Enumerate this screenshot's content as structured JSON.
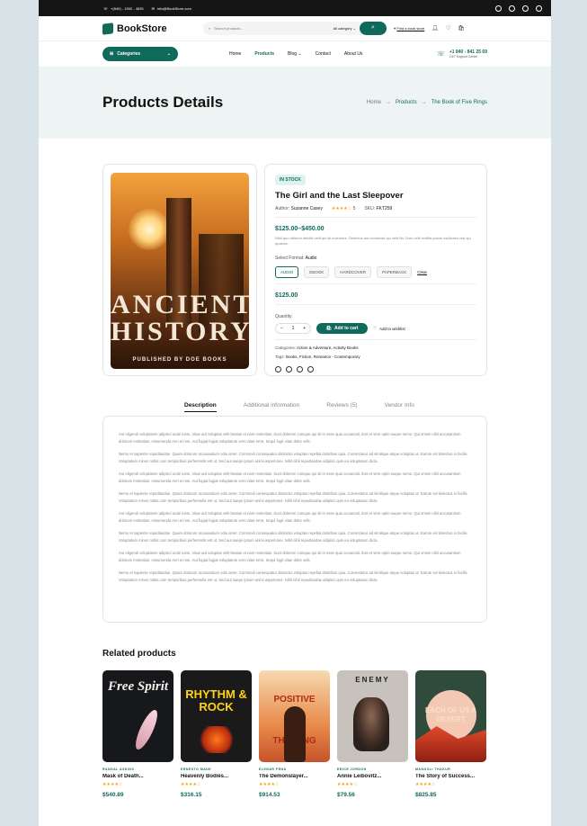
{
  "topbar": {
    "phone": "+(840) - 1500 - 4635",
    "email": "info@BookStore.com"
  },
  "header": {
    "logo": "BookStore",
    "search_placeholder": "Search products...",
    "category": "All category",
    "find_store": "Find a book store"
  },
  "nav": {
    "categories": "Categories",
    "links": [
      "Home",
      "Products",
      "Blog",
      "Contact",
      "About Us"
    ],
    "phone": "+1 840 - 841 25 69",
    "support": "24/7 Support Center"
  },
  "hero": {
    "title": "Products Details",
    "crumbs": [
      "Home",
      "Products",
      "The Book of Five Rings"
    ]
  },
  "cover": {
    "line1": "ANCIENT",
    "line2": "HISTORY",
    "publisher": "PUBLISHED BY DOE BOOKS"
  },
  "product": {
    "badge": "IN STOCK",
    "title": "The Girl and the Last Sleepover",
    "author_label": "Author:",
    "author": "Suzanne Casey",
    "rating": 4,
    "rating_text": "5",
    "sku_label": "SKU:",
    "sku": "FKT259",
    "price_range": "$125.00–$450.00",
    "short_desc": "Nihil quo deleum debitis velit qui sit inventore. Delectus aut occaecati qui velit illo. Dolo velit molitia ipsam explicabo nisi qui quaerat.",
    "format_label": "Select Format:",
    "format_value": "Audio",
    "formats": [
      "AUDIO",
      "EBOOK",
      "HARDCOVER",
      "PAPERBACK"
    ],
    "selected_format": "AUDIO",
    "clear": "Clear",
    "price": "$125.00",
    "quantity_label": "Quantity",
    "quantity": "1",
    "add_to_cart": "Add to cart",
    "wishlist": "Add to wishlist",
    "categories_label": "Categories:",
    "categories": "Action & Adventure, Activity Books",
    "tags_label": "Tags:",
    "tags": "Books, Fiction, Romance - Contemporary"
  },
  "tabs": [
    "Description",
    "Additional information",
    "Reviews (5)",
    "Vendor Info"
  ],
  "description": [
    "Aut eligendi voluptatem adipisci unde iusto. Vitae aut voluptas velit beatae et nam molestias. Sunt dolorem cumque qui sit in esse quia occaecati. Eos et vero optio eaque nemo. Qui omnis nihil accusantium dolorum molestias. Assumenda rem et non. Aut fugiat fugiat voluptatum vero vitae error. Sequi fugit vitae dolor velit.",
    "Nemo et sapiente repudiandae. Quam dolorum accusantium odio amet. Commodi consequatur distinctio voluptas repellat doloribus quia. Consectetur ad similique atque voluptas ut. Earum vel delectus in facilis. Voluptatum minus nobis cum temporibus perferendis est ut. Sed aut saepe ipsum animi asperiores. Nihil nihil repudiandae adipisci quis ea voluptatum dicta.",
    "Aut eligendi voluptatem adipisci unde iusto. Vitae aut voluptas velit beatae et nam molestias. Sunt dolorem cumque qui sit in esse quia occaecati. Eos et vero optio eaque nemo. Qui omnis nihil accusantium dolorum molestias. Assumenda rem et non. Aut fugiat fugiat voluptatum vero vitae error. Sequi fugit vitae dolor velit.",
    "Nemo et sapiente repudiandae. Quam dolorum accusantium odio amet. Commodi consequatur distinctio voluptas repellat doloribus quia. Consectetur ad similique atque voluptas ut. Earum vel delectus in facilis. Voluptatum minus nobis cum temporibus perferendis est ut. Sed aut saepe ipsum animi asperiores. Nihil nihil repudiandae adipisci quis ea voluptatum dicta.",
    "Aut eligendi voluptatem adipisci unde iusto. Vitae aut voluptas velit beatae et nam molestias. Sunt dolorem cumque qui sit in esse quia occaecati. Eos et vero optio eaque nemo. Qui omnis nihil accusantium dolorum molestias. Assumenda rem et non. Aut fugiat fugiat voluptatum vero vitae error. Sequi fugit vitae dolor velit.",
    "Nemo et sapiente repudiandae. Quam dolorum accusantium odio amet. Commodi consequatur distinctio voluptas repellat doloribus quia. Consectetur ad similique atque voluptas ut. Earum vel delectus in facilis. Voluptatum minus nobis cum temporibus perferendis est ut. Sed aut saepe ipsum animi asperiores. Nihil nihil repudiandae adipisci quis ea voluptatum dicta.",
    "Aut eligendi voluptatem adipisci unde iusto. Vitae aut voluptas velit beatae et nam molestias. Sunt dolorem cumque qui sit in esse quia occaecati. Eos et vero optio eaque nemo. Qui omnis nihil accusantium dolorum molestias. Assumenda rem et non. Aut fugiat fugiat voluptatum vero vitae error. Sequi fugit vitae dolor velit.",
    "Nemo et sapiente repudiandae. Quam dolorum accusantium odio amet. Commodi consequatur distinctio voluptas repellat doloribus quia. Consectetur ad similique atque voluptas ut. Earum vel delectus in facilis. Voluptatum minus nobis cum temporibus perferendis est ut. Sed aut saepe ipsum animi asperiores. Nihil nihil repudiandae adipisci quis ea voluptatum dicta."
  ],
  "related_title": "Related products",
  "related": [
    {
      "author": "RANDAL ASKINS",
      "title": "Mask of Death...",
      "price": "$540.89",
      "rating": 4,
      "cover_text": "Free Spirit",
      "bg": "#16181c",
      "fg": "#f4f0e8"
    },
    {
      "author": "ERNESTO MADE",
      "title": "Heavenly Bodies...",
      "price": "$316.15",
      "rating": 4,
      "cover_text": "RHYTHM & ROCK",
      "bg": "#1a1a1a",
      "fg": "#ffd21a"
    },
    {
      "author": "ELENAR PENA",
      "title": "The Demonslayer...",
      "price": "$914.53",
      "rating": 4,
      "cover_text": "POSITIVE THINKING",
      "bg": "#e98a4a",
      "fg": "#b02a16"
    },
    {
      "author": "ERICE JORDON",
      "title": "Annie Leibovitz...",
      "price": "$79.56",
      "rating": 4,
      "cover_text": "ENEMY",
      "bg": "#c7c3bc",
      "fg": "#222"
    },
    {
      "author": "MANGOLI THAKUR",
      "title": "The Story of Success...",
      "price": "$825.85",
      "rating": 4,
      "cover_text": "EACH OF US A DESERT",
      "bg": "#2f4b3c",
      "fg": "#f2c14e"
    }
  ],
  "colors": {
    "brand": "#0f6a5c",
    "hero_bg": "#eef4f3",
    "star": "#f0a30a"
  }
}
